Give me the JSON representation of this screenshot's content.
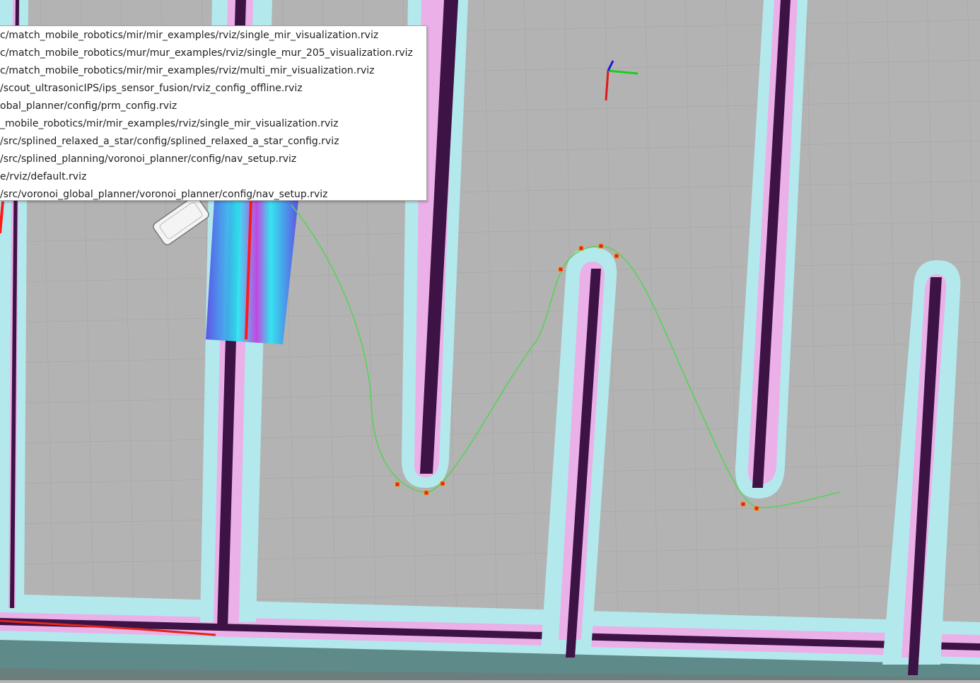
{
  "recent_configs_menu": {
    "items": [
      {
        "label": "c/match_mobile_robotics/mir/mir_examples/rviz/single_mir_visualization.rviz"
      },
      {
        "label": "c/match_mobile_robotics/mur/mur_examples/rviz/single_mur_205_visualization.rviz"
      },
      {
        "label": "c/match_mobile_robotics/mir/mir_examples/rviz/multi_mir_visualization.rviz"
      },
      {
        "label": "/scout_ultrasonicIPS/ips_sensor_fusion/rviz_config_offline.rviz"
      },
      {
        "label": "obal_planner/config/prm_config.rviz"
      },
      {
        "label": "_mobile_robotics/mir/mir_examples/rviz/single_mir_visualization.rviz"
      },
      {
        "label": "/src/splined_relaxed_a_star/config/splined_relaxed_a_star_config.rviz"
      },
      {
        "label": "/src/splined_planning/voronoi_planner/config/nav_setup.rviz"
      },
      {
        "label": "e/rviz/default.rviz"
      },
      {
        "label": "/src/voronoi_global_planner/voronoi_planner/config/nav_setup.rviz"
      }
    ]
  },
  "scene": {
    "colors": {
      "free_space": "#b3b3b3",
      "grid_line": "#9e9e9e",
      "inflation": "#b3e9ec",
      "inscribed": "#ebb0e8",
      "obstacle": "#3d1245",
      "unknown": "#5f8a8a",
      "path": "#53d453",
      "waypoint": "#e0261a",
      "axis_x": "#e01818",
      "axis_y": "#18d018",
      "axis_z": "#1818e0"
    },
    "icons": [
      "robot-model-icon",
      "tf-axes-icon"
    ]
  }
}
